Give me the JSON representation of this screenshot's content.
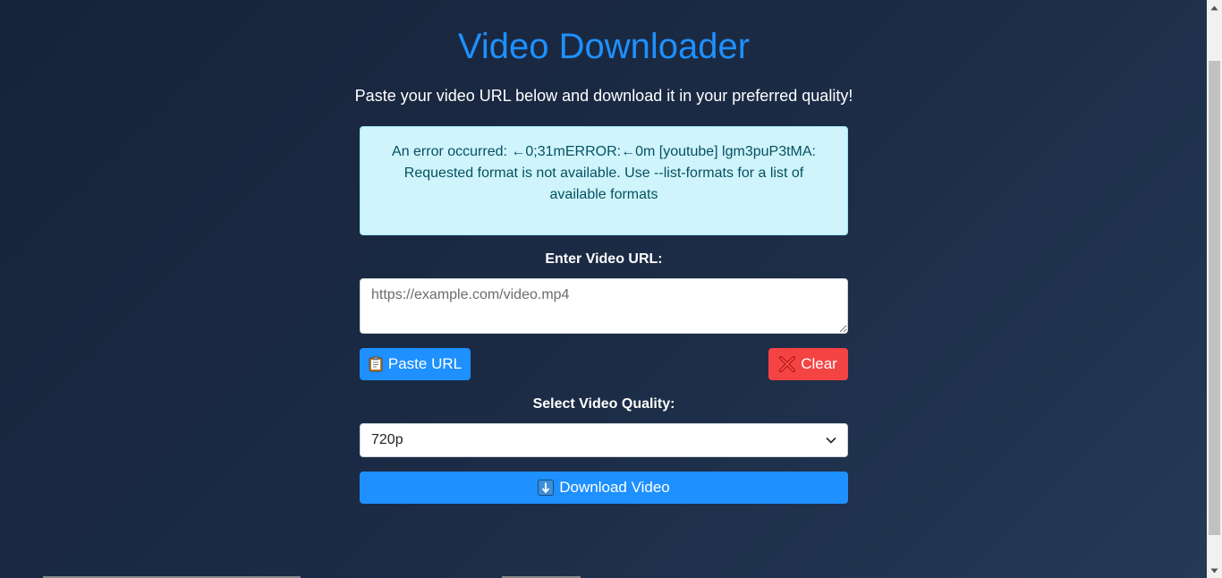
{
  "header": {
    "title": "Video Downloader",
    "subtitle": "Paste your video URL below and download it in your preferred quality!"
  },
  "alert": {
    "message": "An error occurred: ←0;31mERROR:←0m [youtube] lgm3puP3tMA: Requested format is not available. Use --list-formats for a list of available formats"
  },
  "url_field": {
    "label": "Enter Video URL:",
    "placeholder": "https://example.com/video.mp4",
    "value": ""
  },
  "buttons": {
    "paste_label": "Paste URL",
    "paste_icon": "clipboard-icon",
    "clear_label": "Clear",
    "clear_icon": "cross-mark-icon",
    "download_label": "Download Video",
    "download_icon": "down-arrow-icon"
  },
  "quality": {
    "label": "Select Video Quality:",
    "selected": "720p"
  },
  "colors": {
    "accent": "#1e90ff",
    "danger": "#f44343",
    "alert_bg": "#cff4fc",
    "alert_text": "#055160"
  }
}
